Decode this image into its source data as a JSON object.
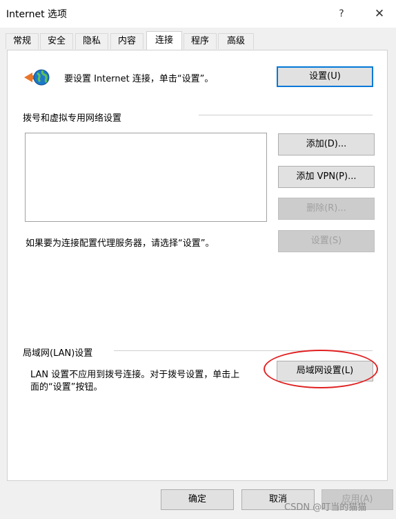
{
  "window": {
    "title": "Internet 选项",
    "help_glyph": "?",
    "close_glyph": "✕"
  },
  "tabs": [
    {
      "label": "常规",
      "active": false
    },
    {
      "label": "安全",
      "active": false
    },
    {
      "label": "隐私",
      "active": false
    },
    {
      "label": "内容",
      "active": false
    },
    {
      "label": "连接",
      "active": true
    },
    {
      "label": "程序",
      "active": false
    },
    {
      "label": "高级",
      "active": false
    }
  ],
  "setup": {
    "icon": "globe-icon",
    "text": "要设置 Internet 连接，单击“设置”。",
    "button": "设置(U)"
  },
  "dialup": {
    "header": "拨号和虚拟专用网络设置",
    "add_button": "添加(D)...",
    "add_vpn_button": "添加 VPN(P)...",
    "delete_button": "删除(R)...",
    "settings_button": "设置(S)",
    "proxy_text": "如果要为连接配置代理服务器，请选择“设置”。"
  },
  "lan": {
    "header": "局域网(LAN)设置",
    "desc_line1": "LAN 设置不应用到拨号连接。对于拨号设置，单击上",
    "desc_line2": "面的“设置”按钮。",
    "button": "局域网设置(L)"
  },
  "footer": {
    "ok": "确定",
    "cancel": "取消",
    "apply": "应用(A)"
  },
  "watermark": "CSDN @叮当的猫猫",
  "colors": {
    "highlight_circle": "#e02020",
    "default_button_border": "#0078d7"
  }
}
